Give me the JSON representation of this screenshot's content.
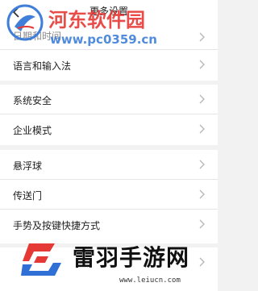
{
  "header": {
    "title": "更多设置"
  },
  "watermark_top": {
    "text": "河东软件园",
    "url": "www.pc0359.cn"
  },
  "groups": [
    {
      "items": [
        {
          "label": "日期和时间"
        },
        {
          "label": "语言和输入法"
        }
      ]
    },
    {
      "items": [
        {
          "label": "系统安全"
        },
        {
          "label": "企业模式"
        }
      ]
    },
    {
      "items": [
        {
          "label": "悬浮球"
        },
        {
          "label": "传送门"
        },
        {
          "label": "手势及按键快捷方式"
        }
      ]
    },
    {
      "items": [
        {
          "label": ""
        }
      ]
    }
  ],
  "watermark_bottom": {
    "text": "雷羽手游网",
    "url": "www.leiucn.com"
  },
  "colors": {
    "accent_red": "#e53935",
    "accent_blue": "#3f7fd9",
    "chevron": "#b5b5b5"
  },
  "icons": {
    "back": "back-arrow-icon",
    "chevron": "chevron-right-icon"
  }
}
